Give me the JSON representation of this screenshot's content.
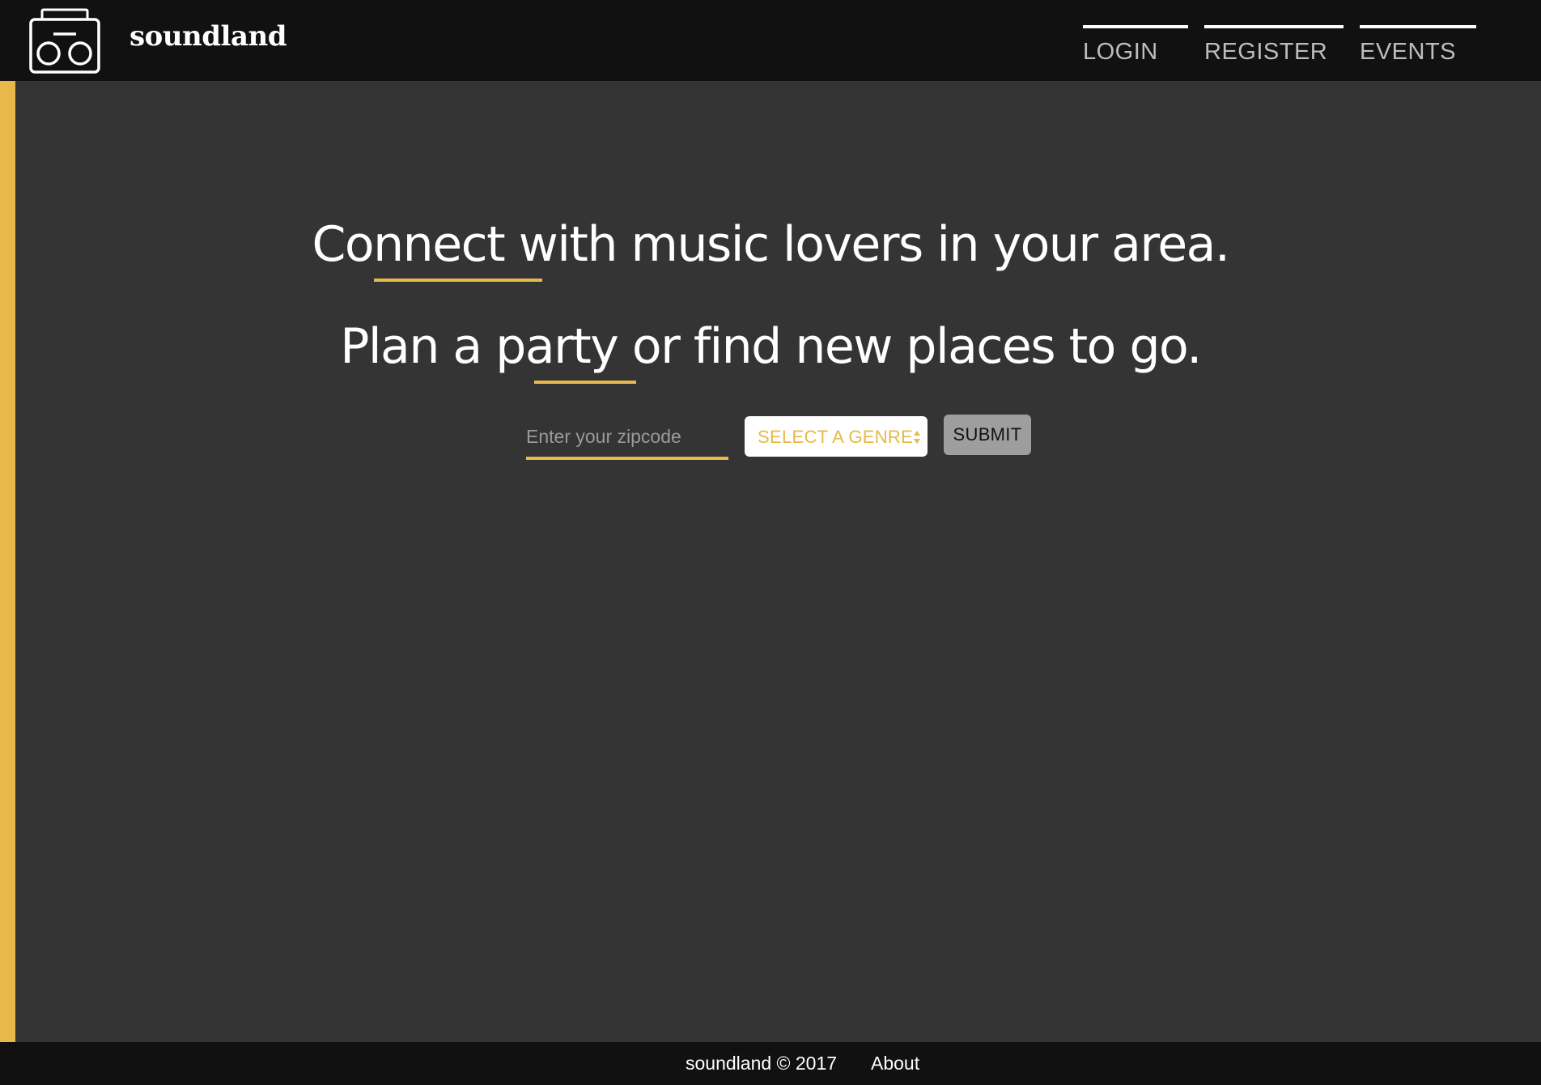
{
  "header": {
    "brand": "soundland",
    "nav": {
      "login": "LOGIN",
      "register": "REGISTER",
      "events": "EVENTS"
    }
  },
  "hero": {
    "line1": "Connect with music lovers in your area.",
    "line2": "Plan a party or find new places to go."
  },
  "search": {
    "zip_placeholder": "Enter your zipcode",
    "genre_label": "SELECT A GENRE",
    "submit_label": "SUBMIT"
  },
  "footer": {
    "copyright": "soundland © 2017",
    "about": "About"
  },
  "colors": {
    "accent": "#e8b84a",
    "header_bg": "#111111",
    "page_bg": "#343434"
  },
  "icons": {
    "logo": "boombox-icon",
    "genre_arrows": "select-arrows-icon"
  }
}
